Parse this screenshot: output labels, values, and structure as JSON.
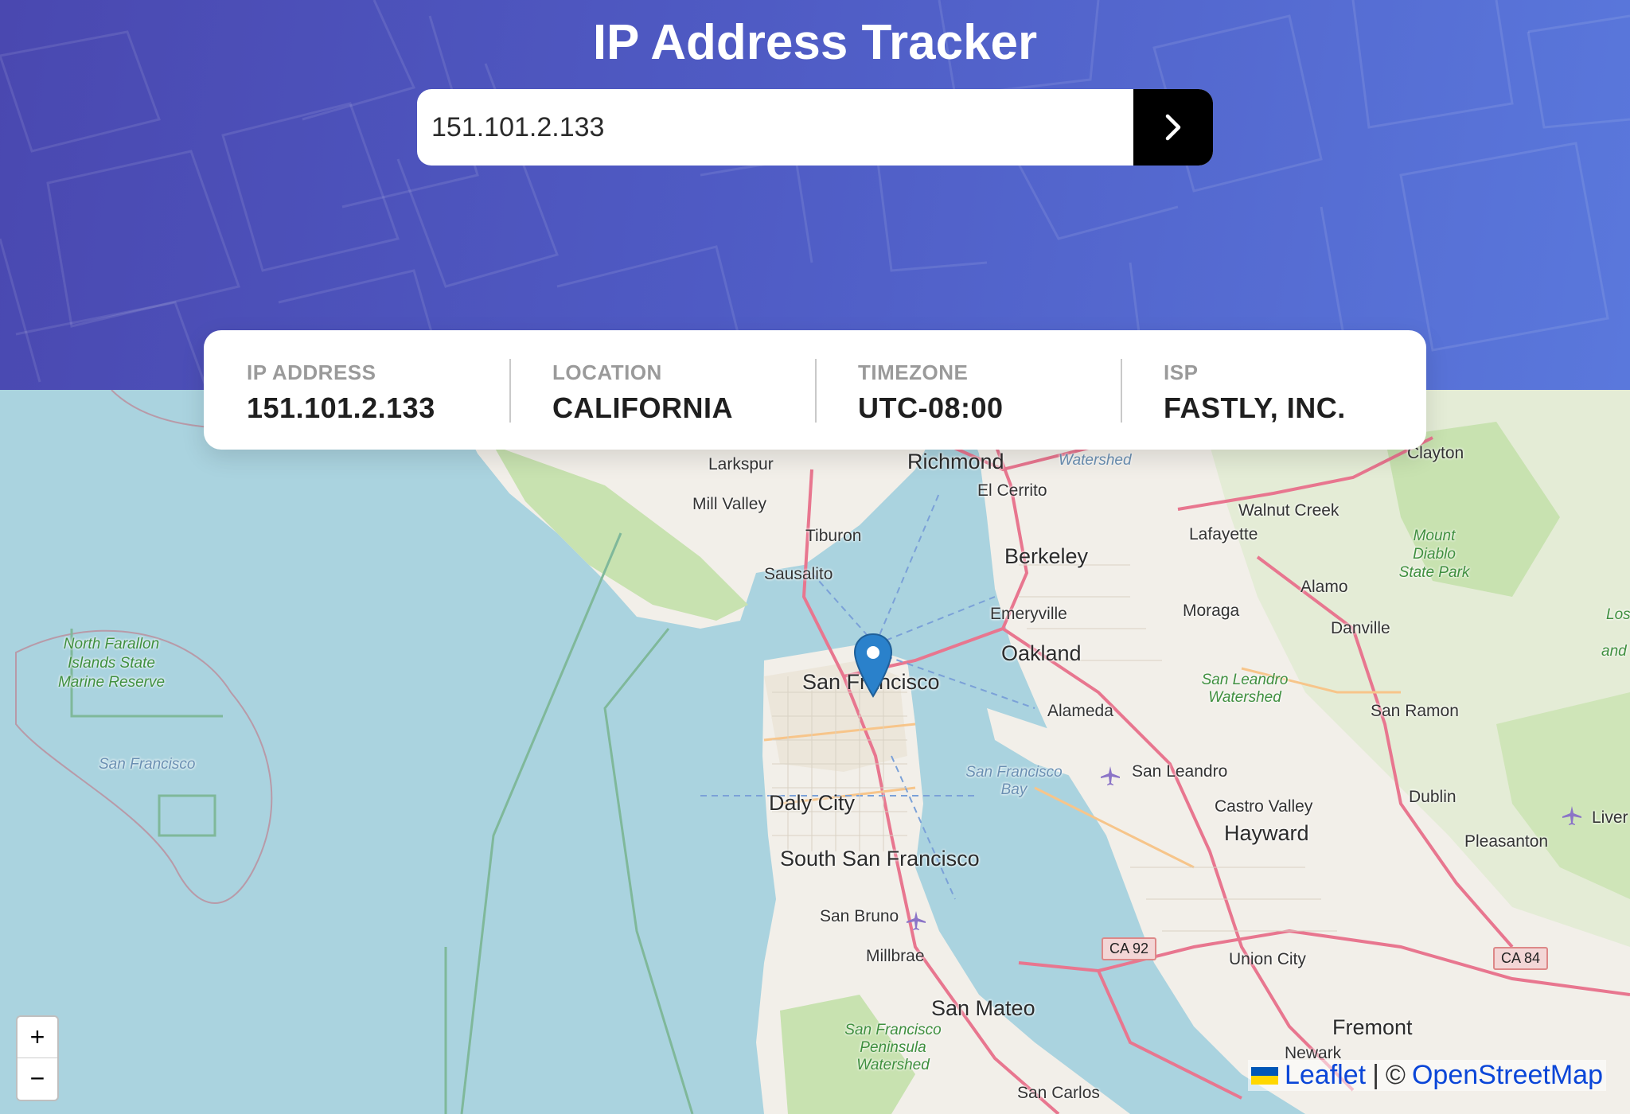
{
  "header": {
    "title": "IP Address Tracker"
  },
  "search": {
    "value": "151.101.2.133",
    "submit_icon": "chevron-right-icon"
  },
  "info": {
    "ip_label": "IP Address",
    "ip_value": "151.101.2.133",
    "location_label": "Location",
    "location_value": "CALIFORNIA",
    "timezone_label": "Timezone",
    "timezone_value": "UTC-08:00",
    "isp_label": "ISP",
    "isp_value": "FASTLY, INC."
  },
  "map": {
    "places": {
      "richmond": "Richmond",
      "larkspur": "Larkspur",
      "el_cerrito": "El Cerrito",
      "watershed_top": "Watershed",
      "clayton": "Clayton",
      "mill_valley": "Mill Valley",
      "walnut_creek": "Walnut Creek",
      "lafayette": "Lafayette",
      "mount_diablo": "Mount Diablo State Park",
      "tiburon": "Tiburon",
      "berkeley": "Berkeley",
      "sausalito": "Sausalito",
      "alamo": "Alamo",
      "moraga": "Moraga",
      "emeryville": "Emeryville",
      "danville": "Danville",
      "north_farallon": "North Farallon Islands State Marine Reserve",
      "oakland": "Oakland",
      "san_francisco": "San Francisco",
      "san_leandro_watershed": "San Leandro Watershed",
      "alameda": "Alameda",
      "san_ramon": "San Ramon",
      "san_francisco_small": "San Francisco",
      "sf_bay": "San Francisco Bay",
      "san_leandro": "San Leandro",
      "dublin": "Dublin",
      "daly_city": "Daly City",
      "castro_valley": "Castro Valley",
      "livermore": "Liver",
      "hayward": "Hayward",
      "pleasanton": "Pleasanton",
      "south_san_francisco": "South San Francisco",
      "san_bruno": "San Bruno",
      "millbrae": "Millbrae",
      "union_city": "Union City",
      "san_mateo": "San Mateo",
      "fremont": "Fremont",
      "sf_peninsula_watershed": "San Francisco Peninsula Watershed",
      "newark": "Newark",
      "san_carlos": "San Carlos",
      "los": "Los",
      "and": "and",
      "watershed_left": "Watershed"
    },
    "shields": {
      "ca92": "CA 92",
      "ca84": "CA 84"
    },
    "zoom_in": "+",
    "zoom_out": "−",
    "attribution_leaflet": "Leaflet",
    "attribution_sep": "|",
    "attribution_copy": "©",
    "attribution_osm": "OpenStreetMap"
  },
  "colors": {
    "header_start": "#4a48b0",
    "header_end": "#5a78dc",
    "water": "#aad3df",
    "land": "#f2efe9",
    "park": "#c8e2b0",
    "marker": "#2a81cb"
  }
}
